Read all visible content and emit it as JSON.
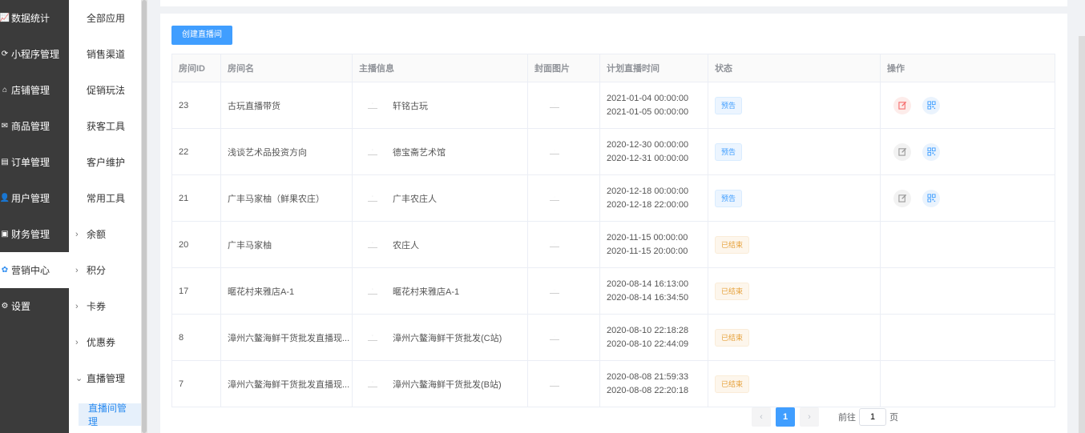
{
  "sidebar": {
    "items": [
      {
        "icon": "chart-icon",
        "glyph": "📈",
        "label": "数据统计"
      },
      {
        "icon": "miniapp-icon",
        "glyph": "⟳",
        "label": "小程序管理"
      },
      {
        "icon": "store-icon",
        "glyph": "⌂",
        "label": "店铺管理"
      },
      {
        "icon": "goods-icon",
        "glyph": "✉",
        "label": "商品管理"
      },
      {
        "icon": "order-icon",
        "glyph": "▤",
        "label": "订单管理"
      },
      {
        "icon": "user-icon",
        "glyph": "👤",
        "label": "用户管理"
      },
      {
        "icon": "finance-icon",
        "glyph": "▣",
        "label": "财务管理"
      },
      {
        "icon": "marketing-icon",
        "glyph": "✿",
        "label": "营销中心"
      },
      {
        "icon": "settings-icon",
        "glyph": "⚙",
        "label": "设置"
      }
    ]
  },
  "submenu": {
    "items": [
      "全部应用",
      "销售渠道",
      "促销玩法",
      "获客工具",
      "客户维护",
      "常用工具"
    ],
    "collapsible": [
      "余额",
      "积分",
      "卡券",
      "优惠券"
    ],
    "open_group": "直播管理",
    "active_child": "直播间管理"
  },
  "toolbar": {
    "create_label": "创建直播间"
  },
  "table": {
    "headers": [
      "房间ID",
      "房间名",
      "主播信息",
      "封面图片",
      "计划直播时间",
      "状态",
      "操作"
    ],
    "rows": [
      {
        "id": "23",
        "name": "古玩直播带货",
        "anchor": "轩铭古玩",
        "start": "2021-01-04 00:00:00",
        "end": "2021-01-05 00:00:00",
        "status": "预告",
        "status_type": "blue",
        "ops": true,
        "edit_hl": true
      },
      {
        "id": "22",
        "name": "浅谈艺术品投资方向",
        "anchor": "德宝斋艺术馆",
        "start": "2020-12-30 00:00:00",
        "end": "2020-12-31 00:00:00",
        "status": "预告",
        "status_type": "blue",
        "ops": true,
        "edit_hl": false
      },
      {
        "id": "21",
        "name": "广丰马家柚（鲜果农庄）",
        "anchor": "广丰农庄人",
        "start": "2020-12-18 00:00:00",
        "end": "2020-12-18 22:00:00",
        "status": "预告",
        "status_type": "blue",
        "ops": true,
        "edit_hl": false
      },
      {
        "id": "20",
        "name": "广丰马家柚",
        "anchor": "农庄人",
        "start": "2020-11-15 00:00:00",
        "end": "2020-11-15 20:00:00",
        "status": "已结束",
        "status_type": "orange",
        "ops": false,
        "edit_hl": false
      },
      {
        "id": "17",
        "name": "暱花村来雅店A-1",
        "anchor": "暱花村来雅店A-1",
        "start": "2020-08-14 16:13:00",
        "end": "2020-08-14 16:34:50",
        "status": "已结束",
        "status_type": "orange",
        "ops": false,
        "edit_hl": false
      },
      {
        "id": "8",
        "name": "漳州六鳌海鲜干货批发直播现...",
        "anchor": "漳州六鳌海鲜干货批发(C站)",
        "start": "2020-08-10 22:18:28",
        "end": "2020-08-10 22:44:09",
        "status": "已结束",
        "status_type": "orange",
        "ops": false,
        "edit_hl": false
      },
      {
        "id": "7",
        "name": "漳州六鳌海鲜干货批发直播现...",
        "anchor": "漳州六鳌海鲜干货批发(B站)",
        "start": "2020-08-08 21:59:33",
        "end": "2020-08-08 22:20:18",
        "status": "已结束",
        "status_type": "orange",
        "ops": false,
        "edit_hl": false
      }
    ]
  },
  "pagination": {
    "prev": "‹",
    "current": "1",
    "next": "›",
    "goto_label": "前往",
    "page_value": "1",
    "page_suffix": "页"
  }
}
